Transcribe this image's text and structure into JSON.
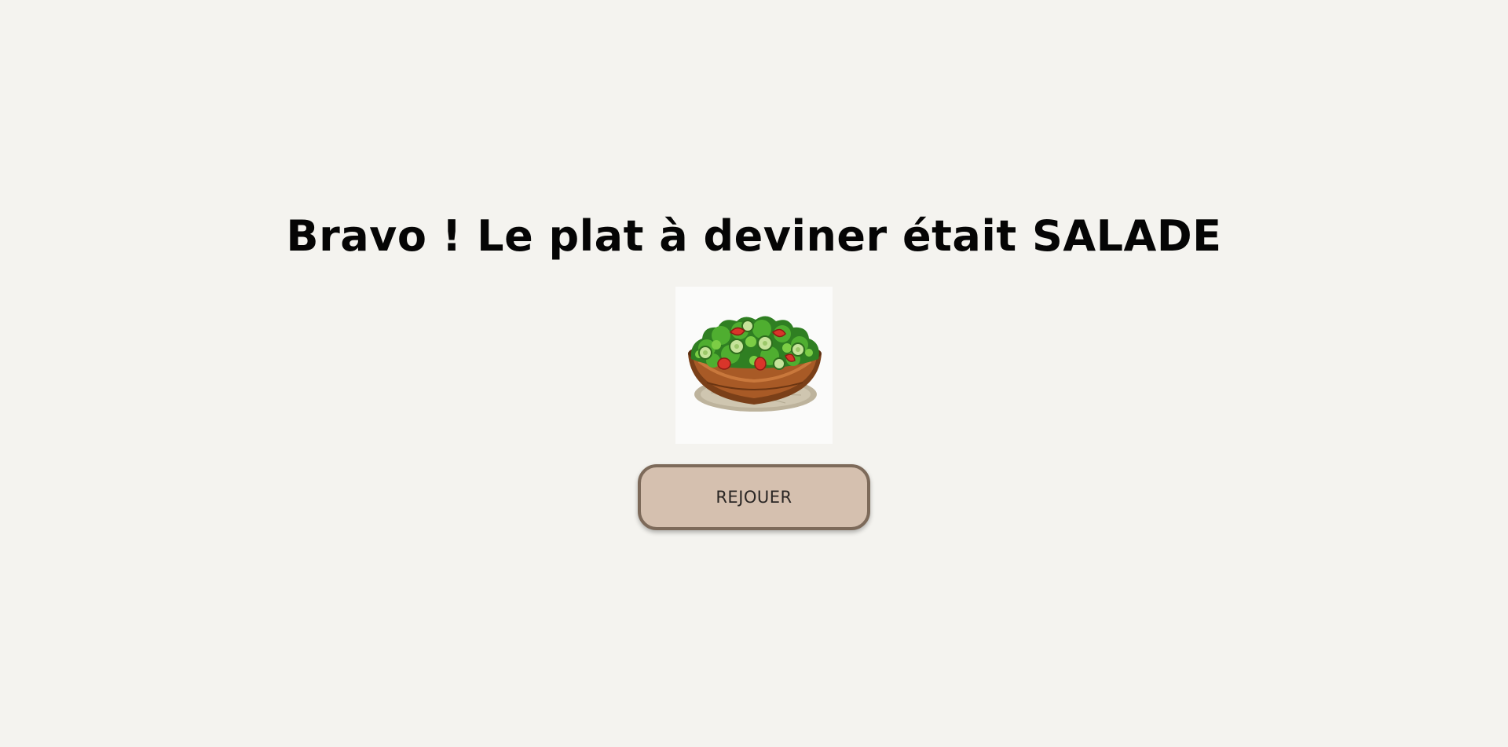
{
  "result": {
    "message": "Bravo ! Le plat à deviner était SALADE"
  },
  "dish": {
    "icon": "salad-bowl-image",
    "colors": {
      "bowl": "#8a4a1f",
      "lettuce": "#3f9a2b",
      "tomato": "#d9352a",
      "cucumber": "#c6e39a"
    }
  },
  "actions": {
    "replay_label": "REJOUER"
  }
}
